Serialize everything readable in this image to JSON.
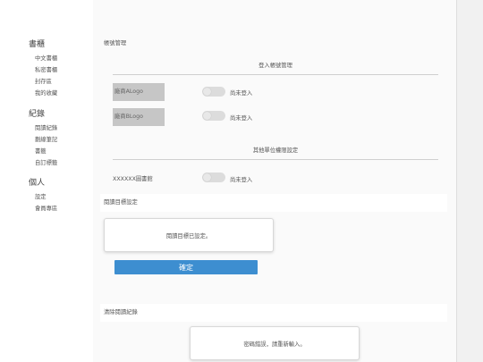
{
  "sidebar": {
    "sections": [
      {
        "title": "書櫃",
        "items": [
          "中文書櫃",
          "私密書櫃",
          "封存區",
          "我的收藏"
        ]
      },
      {
        "title": "紀錄",
        "items": [
          "閱讀紀錄",
          "劃線筆記",
          "書籤",
          "自訂標籤"
        ]
      },
      {
        "title": "個人",
        "items": [
          "設定",
          "會員專區"
        ]
      }
    ]
  },
  "main": {
    "title": "帳號管理",
    "login_header": "登入帳號管理",
    "accounts": [
      {
        "logo": "廠商ALogo",
        "status": "尚未登入"
      },
      {
        "logo": "廠商BLogo",
        "status": "尚未登入"
      }
    ],
    "other_header": "其他單位權限設定",
    "library": {
      "name": "XXXXXX圖書館",
      "status": "尚未登入"
    },
    "reading_goal": {
      "section_title": "閱讀目標設定",
      "message": "閱讀目標已設定。",
      "confirm_label": "確定"
    },
    "clear_history": {
      "section_title": "清除閱讀紀錄",
      "message": "密碼錯誤，請重新輸入。"
    }
  },
  "colors": {
    "accent": "#3d8ed0",
    "toggle_off": "#dcdcdc",
    "logo_placeholder": "#c6c6c6"
  }
}
